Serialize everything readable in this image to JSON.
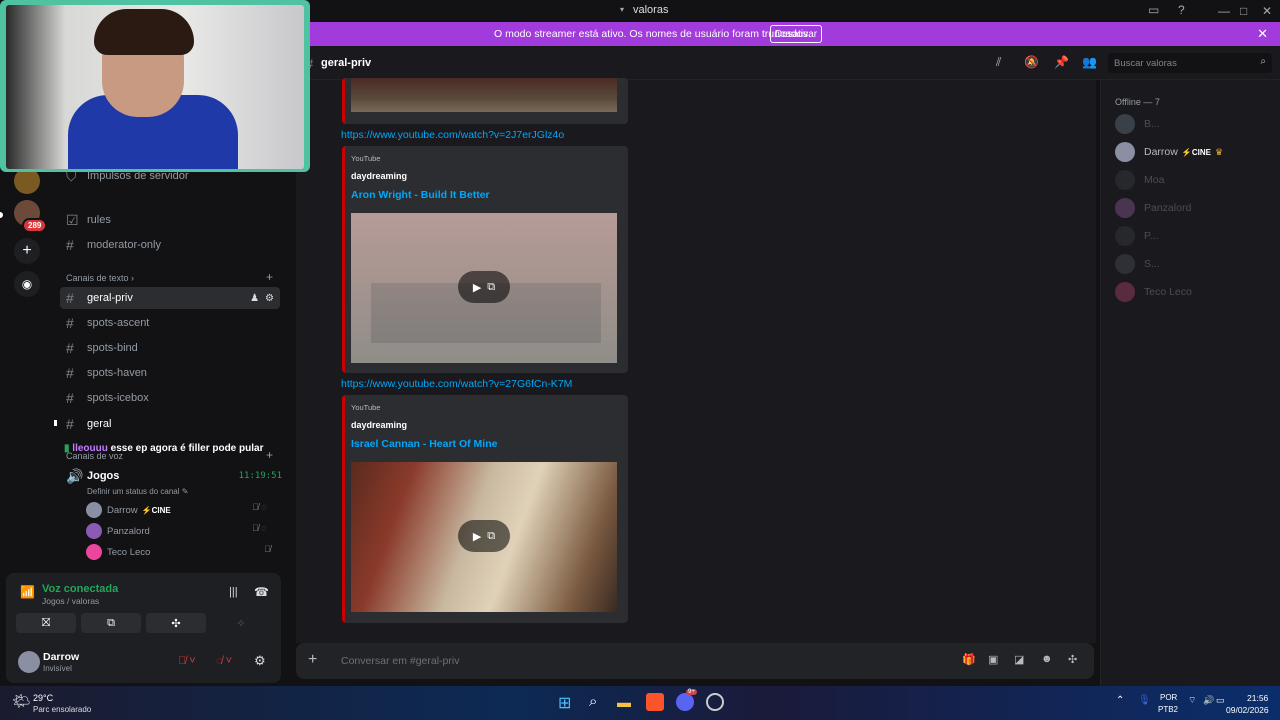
{
  "window": {
    "title": "valoras"
  },
  "banner": {
    "message": "O modo streamer está ativo. Os nomes de usuário foram truncados.",
    "button": "Desativar"
  },
  "rail": {
    "badge": "289"
  },
  "sidebar": {
    "boost_label": "Impulsos de servidor",
    "channels_top": [
      {
        "label": "rules"
      },
      {
        "label": "moderator-only"
      }
    ],
    "text_category": "Canais de texto",
    "text_channels": [
      {
        "label": "geral-priv"
      },
      {
        "label": "spots-ascent"
      },
      {
        "label": "spots-bind"
      },
      {
        "label": "spots-haven"
      },
      {
        "label": "spots-icebox"
      },
      {
        "label": "geral"
      }
    ],
    "voice_category": "Canais de voz",
    "chat_overlay": {
      "user": "lleouuu",
      "text": "esse ep agora é filler pode pular"
    },
    "voice_channel": {
      "name": "Jogos",
      "timer": "11:19:51",
      "status": "Definir um status do canal"
    },
    "voice_users": [
      {
        "name": "Darrow",
        "tag": "CINE"
      },
      {
        "name": "Panzalord"
      },
      {
        "name": "Teco Leco"
      }
    ]
  },
  "voice_panel": {
    "status": "Voz conectada",
    "location": "Jogos / valoras"
  },
  "user_panel": {
    "name": "Darrow",
    "status": "Invisível"
  },
  "chat": {
    "channel": "geral-priv",
    "search_placeholder": "Buscar valoras",
    "input_placeholder": "Conversar em #geral-priv",
    "messages": [
      {
        "link": "https://www.youtube.com/watch?v=2J7erJGlz4o",
        "provider": "YouTube",
        "author": "daydreaming",
        "title": "Aron Wright - Build It Better"
      },
      {
        "link": "https://www.youtube.com/watch?v=27G6fCn-K7M",
        "provider": "YouTube",
        "author": "daydreaming",
        "title": "Israel Cannan - Heart Of Mine"
      }
    ]
  },
  "members": {
    "header": "Offline — 7",
    "list": [
      {
        "name": "B..."
      },
      {
        "name": "Darrow",
        "tag": "CINE"
      },
      {
        "name": "Moa"
      },
      {
        "name": "Panzalord"
      },
      {
        "name": "P..."
      },
      {
        "name": "S..."
      },
      {
        "name": "Teco Leco"
      }
    ]
  },
  "taskbar": {
    "weather_temp": "29°C",
    "weather_desc": "Parc ensolarado",
    "lang": "POR",
    "layout": "PTB2",
    "time": "21:56",
    "date": "09/02/2026",
    "discord_badge": "9+"
  },
  "colors": {
    "accent": "#a23bdb",
    "link": "#00a8fc",
    "embed_border": "#cc0000",
    "voice_green": "#23a55a"
  }
}
